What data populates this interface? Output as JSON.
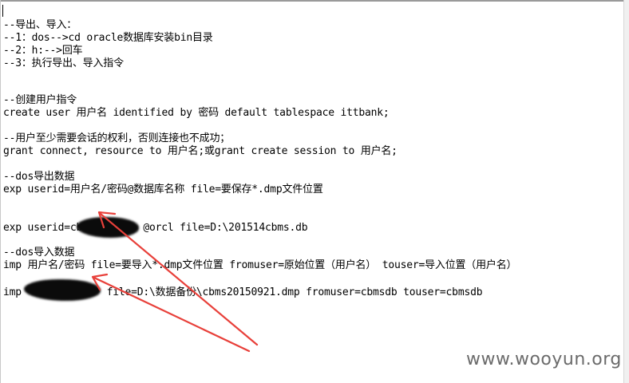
{
  "editor": {
    "lines": [
      "--导出、导入：",
      "--1：dos-->cd oracle数据库安装bin目录",
      "--2：h:-->回车",
      "--3：执行导出、导入指令",
      "--创建用户指令",
      "create user 用户名 identified by 密码 default tablespace ittbank;",
      "--用户至少需要会话的权利，否则连接也不成功；",
      "grant connect, resource to 用户名;或grant create session to 用户名;",
      "--dos导出数据",
      "exp userid=用户名/密码@数据库名称 file=要保存*.dmp文件位置",
      "exp userid=cb          @orcl file=D:\\201514cbms.db",
      "--dos导入数据",
      "imp 用户名/密码 file=要导入*.dmp文件位置 fromuser=原始位置（用户名） touser=导入位置（用户名）",
      "imp              file=D:\\数据备份\\cbms20150921.dmp fromuser=cbmsdb touser=cbmsdb"
    ]
  },
  "annotation": {
    "arrow_color": "#e8403a",
    "redaction_color": "#0b0b0b"
  },
  "watermark": {
    "text": "www.wooyun.org"
  }
}
